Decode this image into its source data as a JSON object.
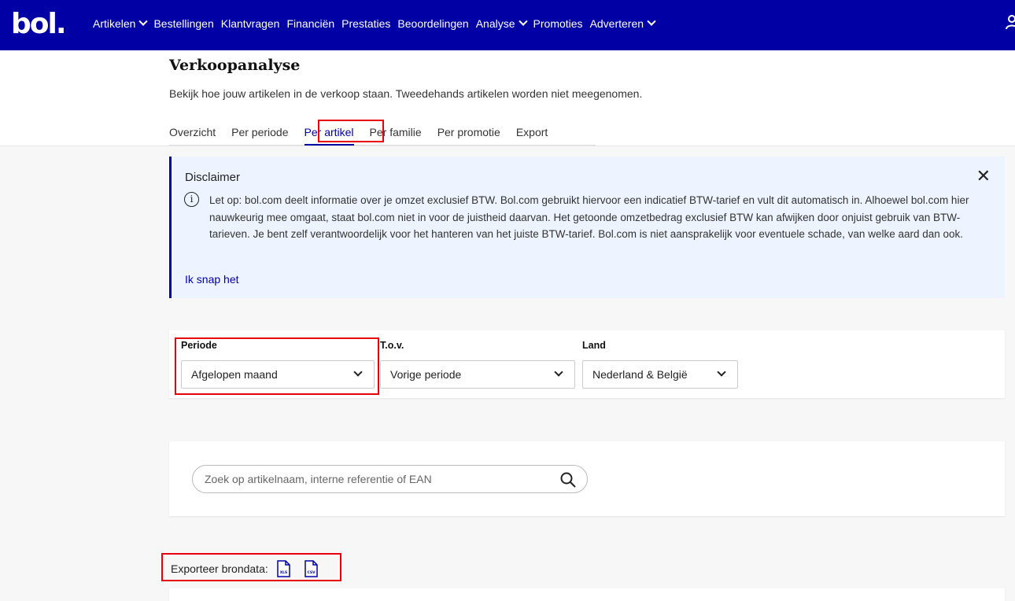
{
  "brand": {
    "logo": "bol."
  },
  "nav": {
    "items": [
      {
        "label": "Artikelen",
        "dropdown": true
      },
      {
        "label": "Bestellingen",
        "dropdown": false
      },
      {
        "label": "Klantvragen",
        "dropdown": false
      },
      {
        "label": "Financiën",
        "dropdown": false
      },
      {
        "label": "Prestaties",
        "dropdown": false
      },
      {
        "label": "Beoordelingen",
        "dropdown": false
      },
      {
        "label": "Analyse",
        "dropdown": true
      },
      {
        "label": "Promoties",
        "dropdown": false
      },
      {
        "label": "Adverteren",
        "dropdown": true
      }
    ]
  },
  "page": {
    "title": "Verkoopanalyse",
    "subtitle": "Bekijk hoe jouw artikelen in de verkoop staan. Tweedehands artikelen worden niet meegenomen."
  },
  "tabs": [
    {
      "label": "Overzicht",
      "active": false
    },
    {
      "label": "Per periode",
      "active": false
    },
    {
      "label": "Per artikel",
      "active": true
    },
    {
      "label": "Per familie",
      "active": false
    },
    {
      "label": "Per promotie",
      "active": false
    },
    {
      "label": "Export",
      "active": false
    }
  ],
  "disclaimer": {
    "title": "Disclaimer",
    "text": "Let op: bol.com deelt informatie over je omzet exclusief BTW. Bol.com gebruikt hiervoor een indicatief BTW-tarief en vult dit automatisch in. Alhoewel bol.com hier nauwkeurig mee omgaat, staat bol.com niet in voor de juistheid daarvan. Het getoonde omzetbedrag exclusief BTW kan afwijken door onjuist gebruik van BTW-tarieven. Je bent zelf verantwoordelijk voor het hanteren van het juiste BTW-tarief. Bol.com is niet aansprakelijk voor eventuele schade, van welke aard dan ook.",
    "link": "Ik snap het"
  },
  "filters": {
    "periode": {
      "label": "Periode",
      "value": "Afgelopen maand"
    },
    "tov": {
      "label": "T.o.v.",
      "value": "Vorige periode"
    },
    "land": {
      "label": "Land",
      "value": "Nederland & België"
    }
  },
  "search": {
    "placeholder": "Zoek op artikelnaam, interne referentie of EAN"
  },
  "export": {
    "label": "Exporteer brondata:",
    "files": [
      {
        "type": "XLS",
        "icon": "xls-file-icon"
      },
      {
        "type": "CSV",
        "icon": "csv-file-icon"
      }
    ]
  },
  "colors": {
    "brand": "#0000a4",
    "highlight": "#e8000b",
    "disclaimer_bg": "#edf4ff"
  }
}
